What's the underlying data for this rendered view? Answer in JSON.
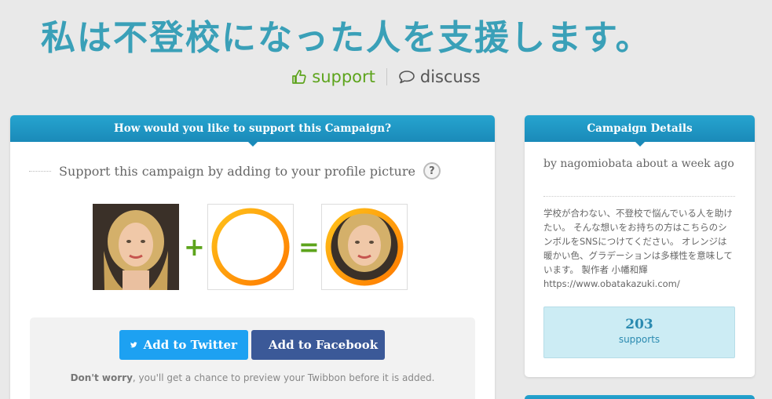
{
  "campaign": {
    "title": "私は不登校になった人を支援します。"
  },
  "nav": {
    "support_label": "support",
    "discuss_label": "discuss"
  },
  "support_panel": {
    "header": "How would you like to support this Campaign?",
    "prompt": "Support this campaign by adding to your profile picture",
    "help_label": "?",
    "plus_symbol": "+",
    "equals_symbol": "=",
    "twitter_button": "Add to Twitter",
    "facebook_button": "Add to Facebook",
    "worry_bold": "Don't worry",
    "worry_rest": ", you'll get a chance to preview your Twibbon before it is added."
  },
  "details_panel": {
    "header": "Campaign Details",
    "byline": "by nagomiobata about a week ago",
    "description": "学校が合わない、不登校で悩んでいる人を助けたい。 そんな想いをお持ちの方はこちらのシンボルをSNSにつけてください。 オレンジは暖かい色、グラデーションは多様性を意味しています。 製作者 小幡和輝 https://www.obatakazuki.com/",
    "supports_count": "203",
    "supports_label": "supports"
  },
  "colors": {
    "title": "#3aa0b8",
    "support_green": "#5da41c",
    "header_blue": "#1a8ab9",
    "twitter": "#1da1f2",
    "facebook": "#3b5998",
    "ring_orange": "#ff8a00"
  },
  "icons": {
    "support": "thumbs-up-icon",
    "discuss": "speech-bubble-icon",
    "help": "question-icon",
    "twitter": "twitter-bird-icon",
    "facebook": "facebook-f-icon"
  }
}
